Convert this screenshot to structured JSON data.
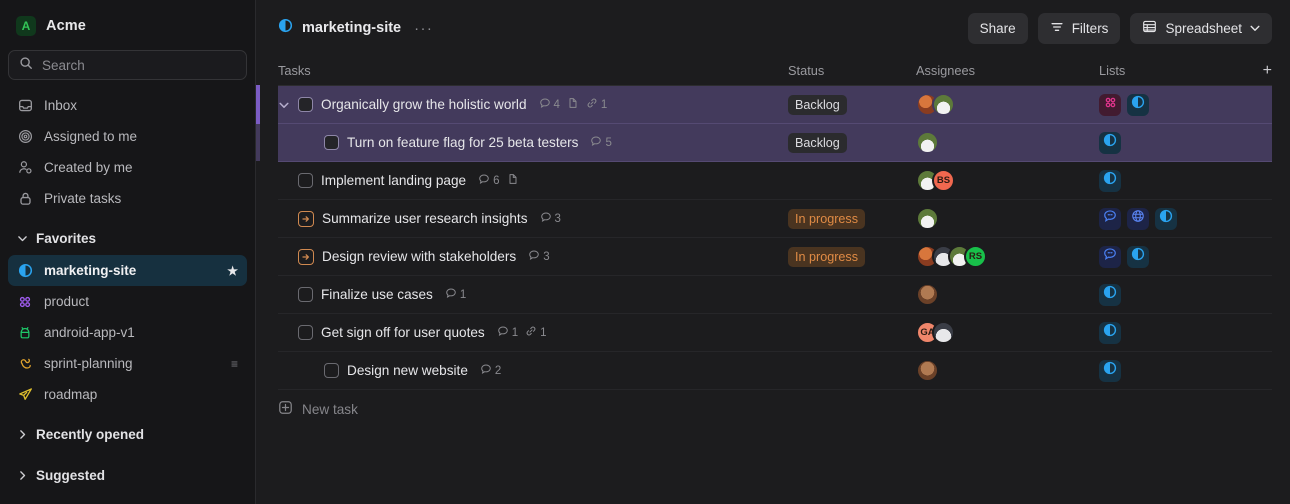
{
  "sidebar": {
    "workspace": {
      "initial": "A",
      "name": "Acme"
    },
    "search": {
      "placeholder": "Search"
    },
    "nav": [
      {
        "label": "Inbox",
        "icon": "inbox-icon"
      },
      {
        "label": "Assigned to me",
        "icon": "target-icon"
      },
      {
        "label": "Created by me",
        "icon": "person-gear-icon"
      },
      {
        "label": "Private tasks",
        "icon": "lock-icon"
      }
    ],
    "favorites_header": "Favorites",
    "favorites": [
      {
        "label": "marketing-site",
        "icon": "half-circle-icon",
        "active": true,
        "starred": true,
        "suffix": ""
      },
      {
        "label": "product",
        "icon": "grid-dots-icon",
        "active": false,
        "starred": false,
        "suffix": ""
      },
      {
        "label": "android-app-v1",
        "icon": "android-icon",
        "active": false,
        "starred": false,
        "suffix": ""
      },
      {
        "label": "sprint-planning",
        "icon": "hand-icon",
        "active": false,
        "starred": false,
        "suffix": "≡"
      },
      {
        "label": "roadmap",
        "icon": "paper-plane-icon",
        "active": false,
        "starred": false,
        "suffix": ""
      }
    ],
    "recently_opened": "Recently opened",
    "suggested": "Suggested"
  },
  "topbar": {
    "breadcrumb": "marketing-site",
    "breadcrumb_icon": "half-circle-icon",
    "overflow": "···",
    "share": "Share",
    "filters": "Filters",
    "view": "Spreadsheet"
  },
  "columns": {
    "tasks": "Tasks",
    "status": "Status",
    "assignees": "Assignees",
    "lists": "Lists",
    "add": "+"
  },
  "rows": [
    {
      "name": "Organically grow the holistic world",
      "selected": true,
      "first_selected": true,
      "expanded": true,
      "indent": 0,
      "checkbox": "filled",
      "status_icon": null,
      "comments": "4",
      "has_doc": true,
      "links": "1",
      "status": "Backlog",
      "status_kind": "backlog",
      "avatars": [
        {
          "kind": "photo",
          "style": "p1"
        },
        {
          "kind": "photo",
          "style": "p2"
        }
      ],
      "lists": [
        {
          "icon": "grid-dots-icon",
          "tint": "pink"
        },
        {
          "icon": "half-circle-icon",
          "tint": "blue"
        }
      ]
    },
    {
      "name": "Turn on feature flag for 25 beta testers",
      "selected": true,
      "first_selected": false,
      "expanded": false,
      "indent": 1,
      "checkbox": "filled",
      "status_icon": null,
      "comments": "5",
      "has_doc": false,
      "links": null,
      "status": "Backlog",
      "status_kind": "backlog",
      "avatars": [
        {
          "kind": "photo",
          "style": "p2"
        }
      ],
      "lists": [
        {
          "icon": "half-circle-icon",
          "tint": "blue"
        }
      ]
    },
    {
      "name": "Implement landing page",
      "selected": false,
      "first_selected": false,
      "expanded": false,
      "indent": 0,
      "checkbox": "empty",
      "status_icon": null,
      "comments": "6",
      "has_doc": true,
      "links": null,
      "status": "",
      "status_kind": "none",
      "avatars": [
        {
          "kind": "photo",
          "style": "p2"
        },
        {
          "kind": "initials",
          "text": "BS",
          "color": "#f0684f"
        }
      ],
      "lists": [
        {
          "icon": "half-circle-icon",
          "tint": "blue"
        }
      ]
    },
    {
      "name": "Summarize user research insights",
      "selected": false,
      "first_selected": false,
      "expanded": false,
      "indent": 0,
      "checkbox": null,
      "status_icon": "arrow-right-square-icon",
      "comments": "3",
      "has_doc": false,
      "links": null,
      "status": "In progress",
      "status_kind": "inprogress",
      "avatars": [
        {
          "kind": "photo",
          "style": "p2"
        }
      ],
      "lists": [
        {
          "icon": "quote-bubble-icon",
          "tint": "indigo"
        },
        {
          "icon": "globe-icon",
          "tint": "indigo"
        },
        {
          "icon": "half-circle-icon",
          "tint": "blue"
        }
      ]
    },
    {
      "name": "Design review with stakeholders",
      "selected": false,
      "first_selected": false,
      "expanded": false,
      "indent": 0,
      "checkbox": null,
      "status_icon": "arrow-right-square-icon",
      "comments": "3",
      "has_doc": false,
      "links": null,
      "status": "In progress",
      "status_kind": "inprogress",
      "avatars": [
        {
          "kind": "photo",
          "style": "p1"
        },
        {
          "kind": "photo",
          "style": "p3"
        },
        {
          "kind": "photo",
          "style": "p2"
        },
        {
          "kind": "initials",
          "text": "RS",
          "color": "#18c04a"
        }
      ],
      "lists": [
        {
          "icon": "quote-bubble-icon",
          "tint": "indigo"
        },
        {
          "icon": "half-circle-icon",
          "tint": "blue"
        }
      ]
    },
    {
      "name": "Finalize use cases",
      "selected": false,
      "first_selected": false,
      "expanded": false,
      "indent": 0,
      "checkbox": "empty",
      "status_icon": null,
      "comments": "1",
      "has_doc": false,
      "links": null,
      "status": "",
      "status_kind": "none",
      "avatars": [
        {
          "kind": "photo",
          "style": "p4"
        }
      ],
      "lists": [
        {
          "icon": "half-circle-icon",
          "tint": "blue"
        }
      ]
    },
    {
      "name": "Get sign off for user quotes",
      "selected": false,
      "first_selected": false,
      "expanded": false,
      "indent": 0,
      "checkbox": "empty",
      "status_icon": null,
      "comments": "1",
      "has_doc": false,
      "links": "1",
      "status": "",
      "status_kind": "none",
      "avatars": [
        {
          "kind": "initials",
          "text": "GA",
          "color": "#f0866b"
        },
        {
          "kind": "photo",
          "style": "p3"
        }
      ],
      "lists": [
        {
          "icon": "half-circle-icon",
          "tint": "blue"
        }
      ]
    },
    {
      "name": "Design new website",
      "selected": false,
      "first_selected": false,
      "expanded": false,
      "indent": 1,
      "checkbox": "empty",
      "status_icon": null,
      "comments": "2",
      "has_doc": false,
      "links": null,
      "status": "",
      "status_kind": "none",
      "avatars": [
        {
          "kind": "photo",
          "style": "p4"
        }
      ],
      "lists": [
        {
          "icon": "half-circle-icon",
          "tint": "blue"
        }
      ]
    }
  ],
  "new_task": "New task"
}
